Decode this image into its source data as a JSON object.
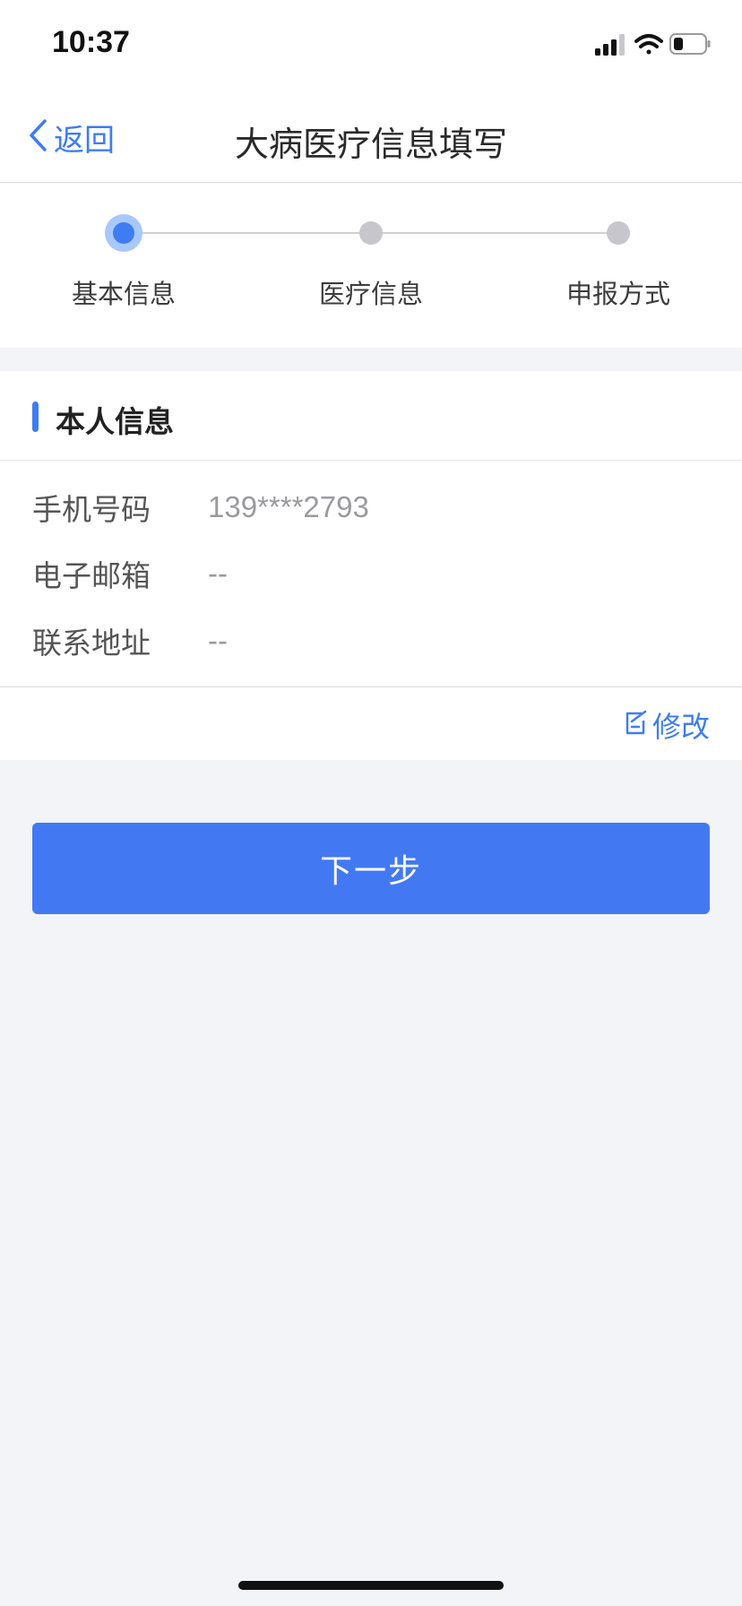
{
  "status_bar": {
    "time": "10:37",
    "icons": [
      "signal-icon",
      "wifi-icon",
      "battery-icon"
    ]
  },
  "nav": {
    "back_label": "返回",
    "title": "大病医疗信息填写"
  },
  "steps": [
    {
      "label": "基本信息",
      "state": "active"
    },
    {
      "label": "医疗信息",
      "state": "todo"
    },
    {
      "label": "申报方式",
      "state": "todo"
    }
  ],
  "section": {
    "title": "本人信息",
    "rows": [
      {
        "label": "手机号码",
        "value": "139****2793"
      },
      {
        "label": "电子邮箱",
        "value": "--"
      },
      {
        "label": "联系地址",
        "value": "--"
      }
    ],
    "edit_label": "修改"
  },
  "next_button": {
    "label": "下一步"
  },
  "colors": {
    "accent": "#3f7cf2",
    "button": "#4279f3",
    "background": "#f2f4f8"
  }
}
